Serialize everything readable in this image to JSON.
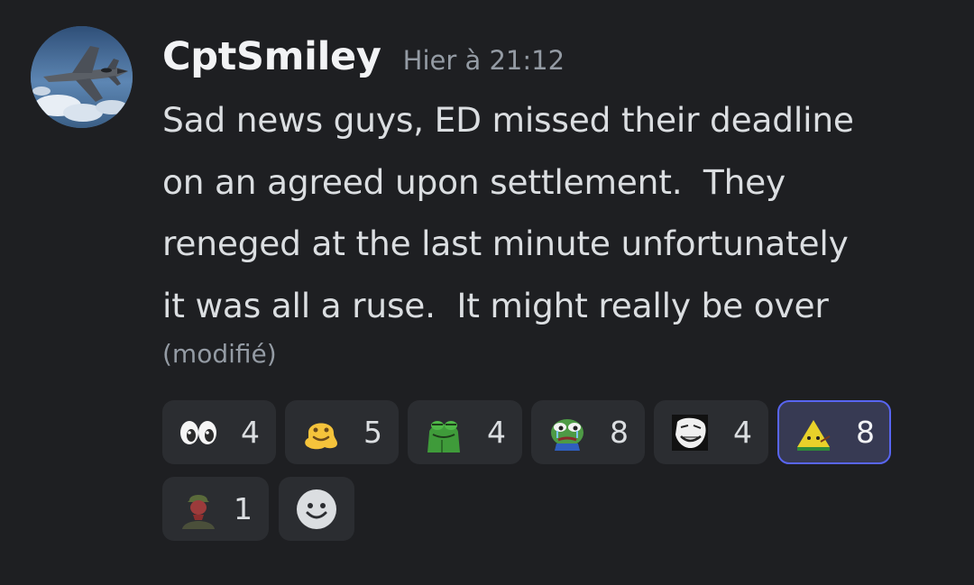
{
  "message": {
    "username": "CptSmiley",
    "timestamp": "Hier à 21:12",
    "lines": [
      "Sad news guys, ED missed their deadline",
      "on an agreed upon settlement.  They",
      "reneged at the last minute unfortunately",
      "it was all a ruse.  It might really be over"
    ],
    "edited_label": "(modifié)"
  },
  "reactions": [
    {
      "icon": "eyes-emoji-icon",
      "count": "4",
      "selected": false
    },
    {
      "icon": "melting-face-emoji-icon",
      "count": "5",
      "selected": false
    },
    {
      "icon": "frog-emoji-icon",
      "count": "4",
      "selected": false
    },
    {
      "icon": "pepe-sad-emoji-icon",
      "count": "8",
      "selected": false
    },
    {
      "icon": "trollface-emoji-icon",
      "count": "4",
      "selected": false
    },
    {
      "icon": "triangle-character-emoji-icon",
      "count": "8",
      "selected": true
    },
    {
      "icon": "soldier-emoji-icon",
      "count": "1",
      "selected": false
    }
  ],
  "colors": {
    "background": "#1e1f22",
    "reaction_bg": "#2b2d31",
    "reaction_selected_bg": "#373a53",
    "reaction_selected_border": "#5865f2",
    "text": "#dbdee1",
    "muted": "#949ba4"
  }
}
